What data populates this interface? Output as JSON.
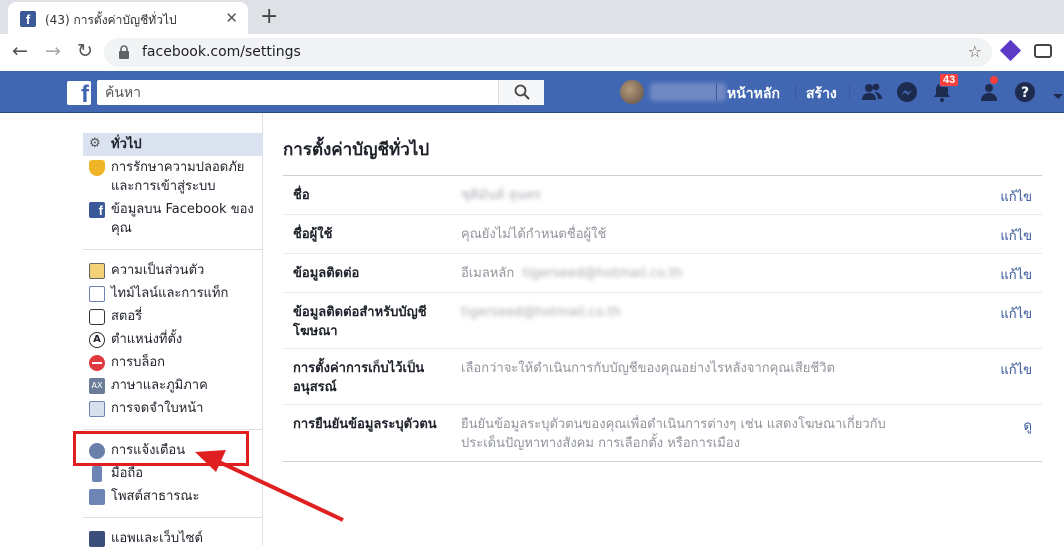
{
  "browser": {
    "tab_title": "(43) การตั้งค่าบัญชีทั่วไป",
    "url": "facebook.com/settings"
  },
  "fb": {
    "search_placeholder": "ค้นหา",
    "profile_name": "นัทธ์นันท์",
    "home": "หน้าหลัก",
    "create": "สร้าง",
    "notif_count": "43"
  },
  "sidebar": {
    "group1": [
      {
        "label": "ทั่วไป",
        "icon": "gears-icon"
      },
      {
        "label": "การรักษาความปลอดภัยและการเข้าสู่ระบบ",
        "icon": "shield-icon"
      },
      {
        "label": "ข้อมูลบน Facebook ของคุณ",
        "icon": "facebook-icon"
      }
    ],
    "group2": [
      {
        "label": "ความเป็นส่วนตัว",
        "icon": "lock-icon"
      },
      {
        "label": "ไทม์ไลน์และการแท็ก",
        "icon": "timeline-icon"
      },
      {
        "label": "สตอรี่",
        "icon": "book-icon"
      },
      {
        "label": "ตำแหน่งที่ตั้ง",
        "icon": "location-icon"
      },
      {
        "label": "การบล็อก",
        "icon": "block-icon"
      },
      {
        "label": "ภาษาและภูมิภาค",
        "icon": "language-icon"
      },
      {
        "label": "การจดจำใบหน้า",
        "icon": "face-icon"
      }
    ],
    "group3": [
      {
        "label": "การแจ้งเตือน",
        "icon": "globe-icon"
      },
      {
        "label": "มือถือ",
        "icon": "mobile-icon"
      },
      {
        "label": "โพสต์สาธารณะ",
        "icon": "rss-icon"
      }
    ],
    "group4": [
      {
        "label": "แอพและเว็บไซต์",
        "icon": "apps-icon"
      }
    ]
  },
  "main": {
    "title": "การตั้งค่าบัญชีทั่วไป",
    "rows": [
      {
        "label": "ชื่อ",
        "value_prefix": "",
        "value_blur": "ชุติมันท์ สุนทร",
        "value": "",
        "action": "แก้ไข"
      },
      {
        "label": "ชื่อผู้ใช้",
        "value_prefix": "",
        "value_blur": "",
        "value": "คุณยังไม่ได้กำหนดชื่อผู้ใช้",
        "action": "แก้ไข"
      },
      {
        "label": "ข้อมูลติดต่อ",
        "value_prefix": "อีเมลหลัก",
        "value_blur": "tigerseed@hotmail.co.th",
        "value": "",
        "action": "แก้ไข"
      },
      {
        "label": "ข้อมูลติดต่อสำหรับบัญชีโฆษณา",
        "value_prefix": "",
        "value_blur": "tigerseed@hotmail.co.th",
        "value": "",
        "action": "แก้ไข"
      },
      {
        "label": "การตั้งค่าการเก็บไว้เป็นอนุสรณ์",
        "value_prefix": "",
        "value_blur": "",
        "value": "เลือกว่าจะให้ดำเนินการกับบัญชีของคุณอย่างไรหลังจากคุณเสียชีวิต",
        "action": "แก้ไข"
      },
      {
        "label": "การยืนยันข้อมูลระบุตัวตน",
        "value_prefix": "",
        "value_blur": "",
        "value": "ยืนยันข้อมูลระบุตัวตนของคุณเพื่อดำเนินการต่างๆ เช่น แสดงโฆษณาเกี่ยวกับประเด็นปัญหาทางสังคม การเลือกตั้ง หรือการเมือง",
        "action": "ดู"
      }
    ]
  },
  "colors": {
    "fb_blue": "#4267b2",
    "link": "#365899",
    "annotation": "#e02020"
  }
}
